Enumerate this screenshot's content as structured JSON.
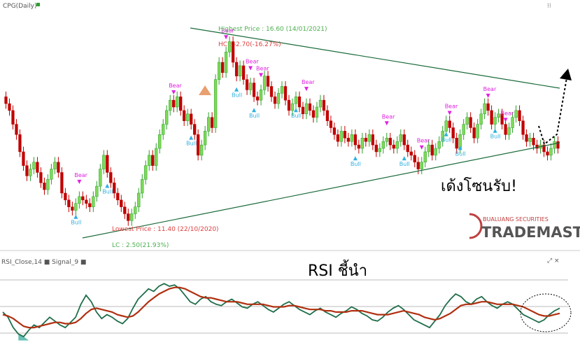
{
  "price_panel": {
    "indicator_label": "CPG(Daily)",
    "highest_label": "Highest Price : 16.60 (14/01/2021)",
    "hc_label": "HC : -2.70(-16.27%)",
    "lowest_label": "Lowest Price : 11.40 (22/10/2020)",
    "lc_label": "LC : 2.50(21.93%)",
    "annotation": "เด้งโซนรับ!",
    "bear_label": "Bear",
    "bull_label": "Bull",
    "logo_top": "BUALUANG SECURITIES",
    "logo_main": "TRADEMASTER",
    "colors": {
      "up": "#2ca02c",
      "down": "#c00000",
      "trend": "#1a6b3a",
      "bear": "#e020e0",
      "bull": "#30b0e0",
      "label_green": "#4caf50",
      "label_red": "#e04040"
    }
  },
  "rsi_panel": {
    "indicator_label": "RSI_Close,14 ■ Signal_9 ■",
    "annotation": "RSI ชี้นำ",
    "colors": {
      "rsi": "#1f6e4a",
      "signal": "#b03010",
      "fill": "#40b0a0"
    }
  },
  "chart_data": [
    {
      "type": "candlestick",
      "title": "CPG(Daily)",
      "ylim": [
        11.0,
        17.2
      ],
      "annotations": [
        "Highest Price : 16.60 (14/01/2021)",
        "HC : -2.70(-16.27%)",
        "Lowest Price : 11.40 (22/10/2020)",
        "LC : 2.50(21.93%)",
        "เด้งโซนรับ!"
      ],
      "close": [
        14.8,
        14.6,
        14.2,
        13.9,
        13.4,
        13.0,
        12.7,
        12.9,
        13.1,
        12.8,
        12.5,
        12.3,
        12.6,
        12.9,
        13.1,
        12.8,
        12.2,
        12.0,
        11.8,
        11.7,
        11.9,
        12.1,
        12.0,
        11.9,
        11.8,
        12.1,
        12.4,
        12.9,
        13.3,
        12.8,
        12.5,
        12.2,
        12.0,
        11.8,
        11.6,
        11.4,
        11.6,
        11.8,
        12.2,
        12.6,
        13.0,
        13.3,
        13.0,
        13.5,
        13.9,
        14.2,
        14.6,
        14.9,
        14.7,
        15.0,
        14.6,
        14.3,
        14.5,
        14.2,
        13.9,
        13.3,
        13.6,
        14.0,
        14.4,
        14.1,
        15.5,
        16.0,
        15.7,
        16.3,
        16.6,
        16.0,
        15.6,
        15.9,
        15.5,
        15.2,
        15.4,
        15.0,
        14.9,
        15.2,
        15.6,
        15.3,
        15.0,
        14.8,
        15.1,
        15.3,
        14.9,
        14.6,
        14.8,
        15.0,
        14.7,
        14.5,
        14.8,
        14.6,
        14.4,
        14.7,
        14.9,
        14.6,
        14.3,
        14.1,
        13.9,
        13.7,
        14.0,
        13.8,
        13.7,
        13.9,
        13.6,
        13.5,
        13.8,
        13.7,
        13.9,
        13.6,
        13.4,
        13.5,
        13.7,
        13.8,
        13.6,
        13.5,
        13.7,
        13.9,
        13.6,
        13.4,
        13.3,
        13.1,
        12.9,
        13.1,
        13.4,
        13.6,
        13.3,
        13.5,
        13.7,
        14.0,
        14.3,
        14.1,
        13.8,
        13.5,
        13.9,
        14.2,
        14.4,
        14.1,
        13.8,
        14.2,
        14.5,
        14.8,
        14.6,
        14.2,
        14.4,
        14.5,
        14.2,
        13.9,
        14.1,
        14.4,
        14.6,
        14.3,
        13.9,
        13.7,
        13.8,
        13.6,
        13.5,
        13.6,
        13.4,
        13.3,
        13.5,
        13.7,
        13.5
      ]
    },
    {
      "type": "line",
      "title": "RSI_Close,14 ■ Signal_9 ■",
      "series": [
        {
          "name": "RSI_Close,14",
          "values": [
            52,
            48,
            40,
            35,
            33,
            38,
            42,
            40,
            44,
            48,
            45,
            42,
            40,
            44,
            48,
            58,
            65,
            60,
            52,
            47,
            50,
            48,
            45,
            43,
            47,
            55,
            62,
            66,
            70,
            68,
            72,
            74,
            72,
            73,
            70,
            65,
            60,
            58,
            62,
            64,
            60,
            58,
            57,
            60,
            62,
            59,
            56,
            55,
            58,
            60,
            57,
            54,
            52,
            55,
            58,
            60,
            57,
            54,
            52,
            50,
            53,
            55,
            52,
            50,
            48,
            51,
            53,
            56,
            54,
            51,
            49,
            46,
            45,
            48,
            52,
            55,
            57,
            54,
            50,
            46,
            44,
            42,
            40,
            45,
            50,
            57,
            62,
            66,
            64,
            60,
            58,
            62,
            64,
            60,
            57,
            55,
            58,
            60,
            58,
            54,
            50,
            48,
            46,
            44,
            46,
            50,
            53,
            55
          ]
        },
        {
          "name": "Signal_9",
          "values": [
            50,
            49,
            47,
            44,
            41,
            40,
            40,
            41,
            42,
            43,
            44,
            44,
            43,
            43,
            44,
            47,
            51,
            54,
            55,
            54,
            53,
            52,
            50,
            49,
            48,
            49,
            52,
            56,
            60,
            63,
            66,
            68,
            70,
            71,
            71,
            70,
            68,
            66,
            64,
            63,
            63,
            62,
            61,
            60,
            60,
            60,
            59,
            58,
            58,
            58,
            58,
            57,
            56,
            56,
            56,
            57,
            57,
            56,
            55,
            54,
            54,
            54,
            53,
            53,
            52,
            52,
            52,
            53,
            53,
            53,
            52,
            51,
            50,
            50,
            50,
            51,
            52,
            53,
            52,
            51,
            50,
            48,
            47,
            46,
            47,
            49,
            51,
            54,
            57,
            58,
            58,
            59,
            60,
            60,
            59,
            58,
            58,
            58,
            58,
            57,
            56,
            54,
            52,
            50,
            49,
            49,
            50,
            51
          ]
        }
      ],
      "ylim": [
        20,
        85
      ]
    }
  ]
}
